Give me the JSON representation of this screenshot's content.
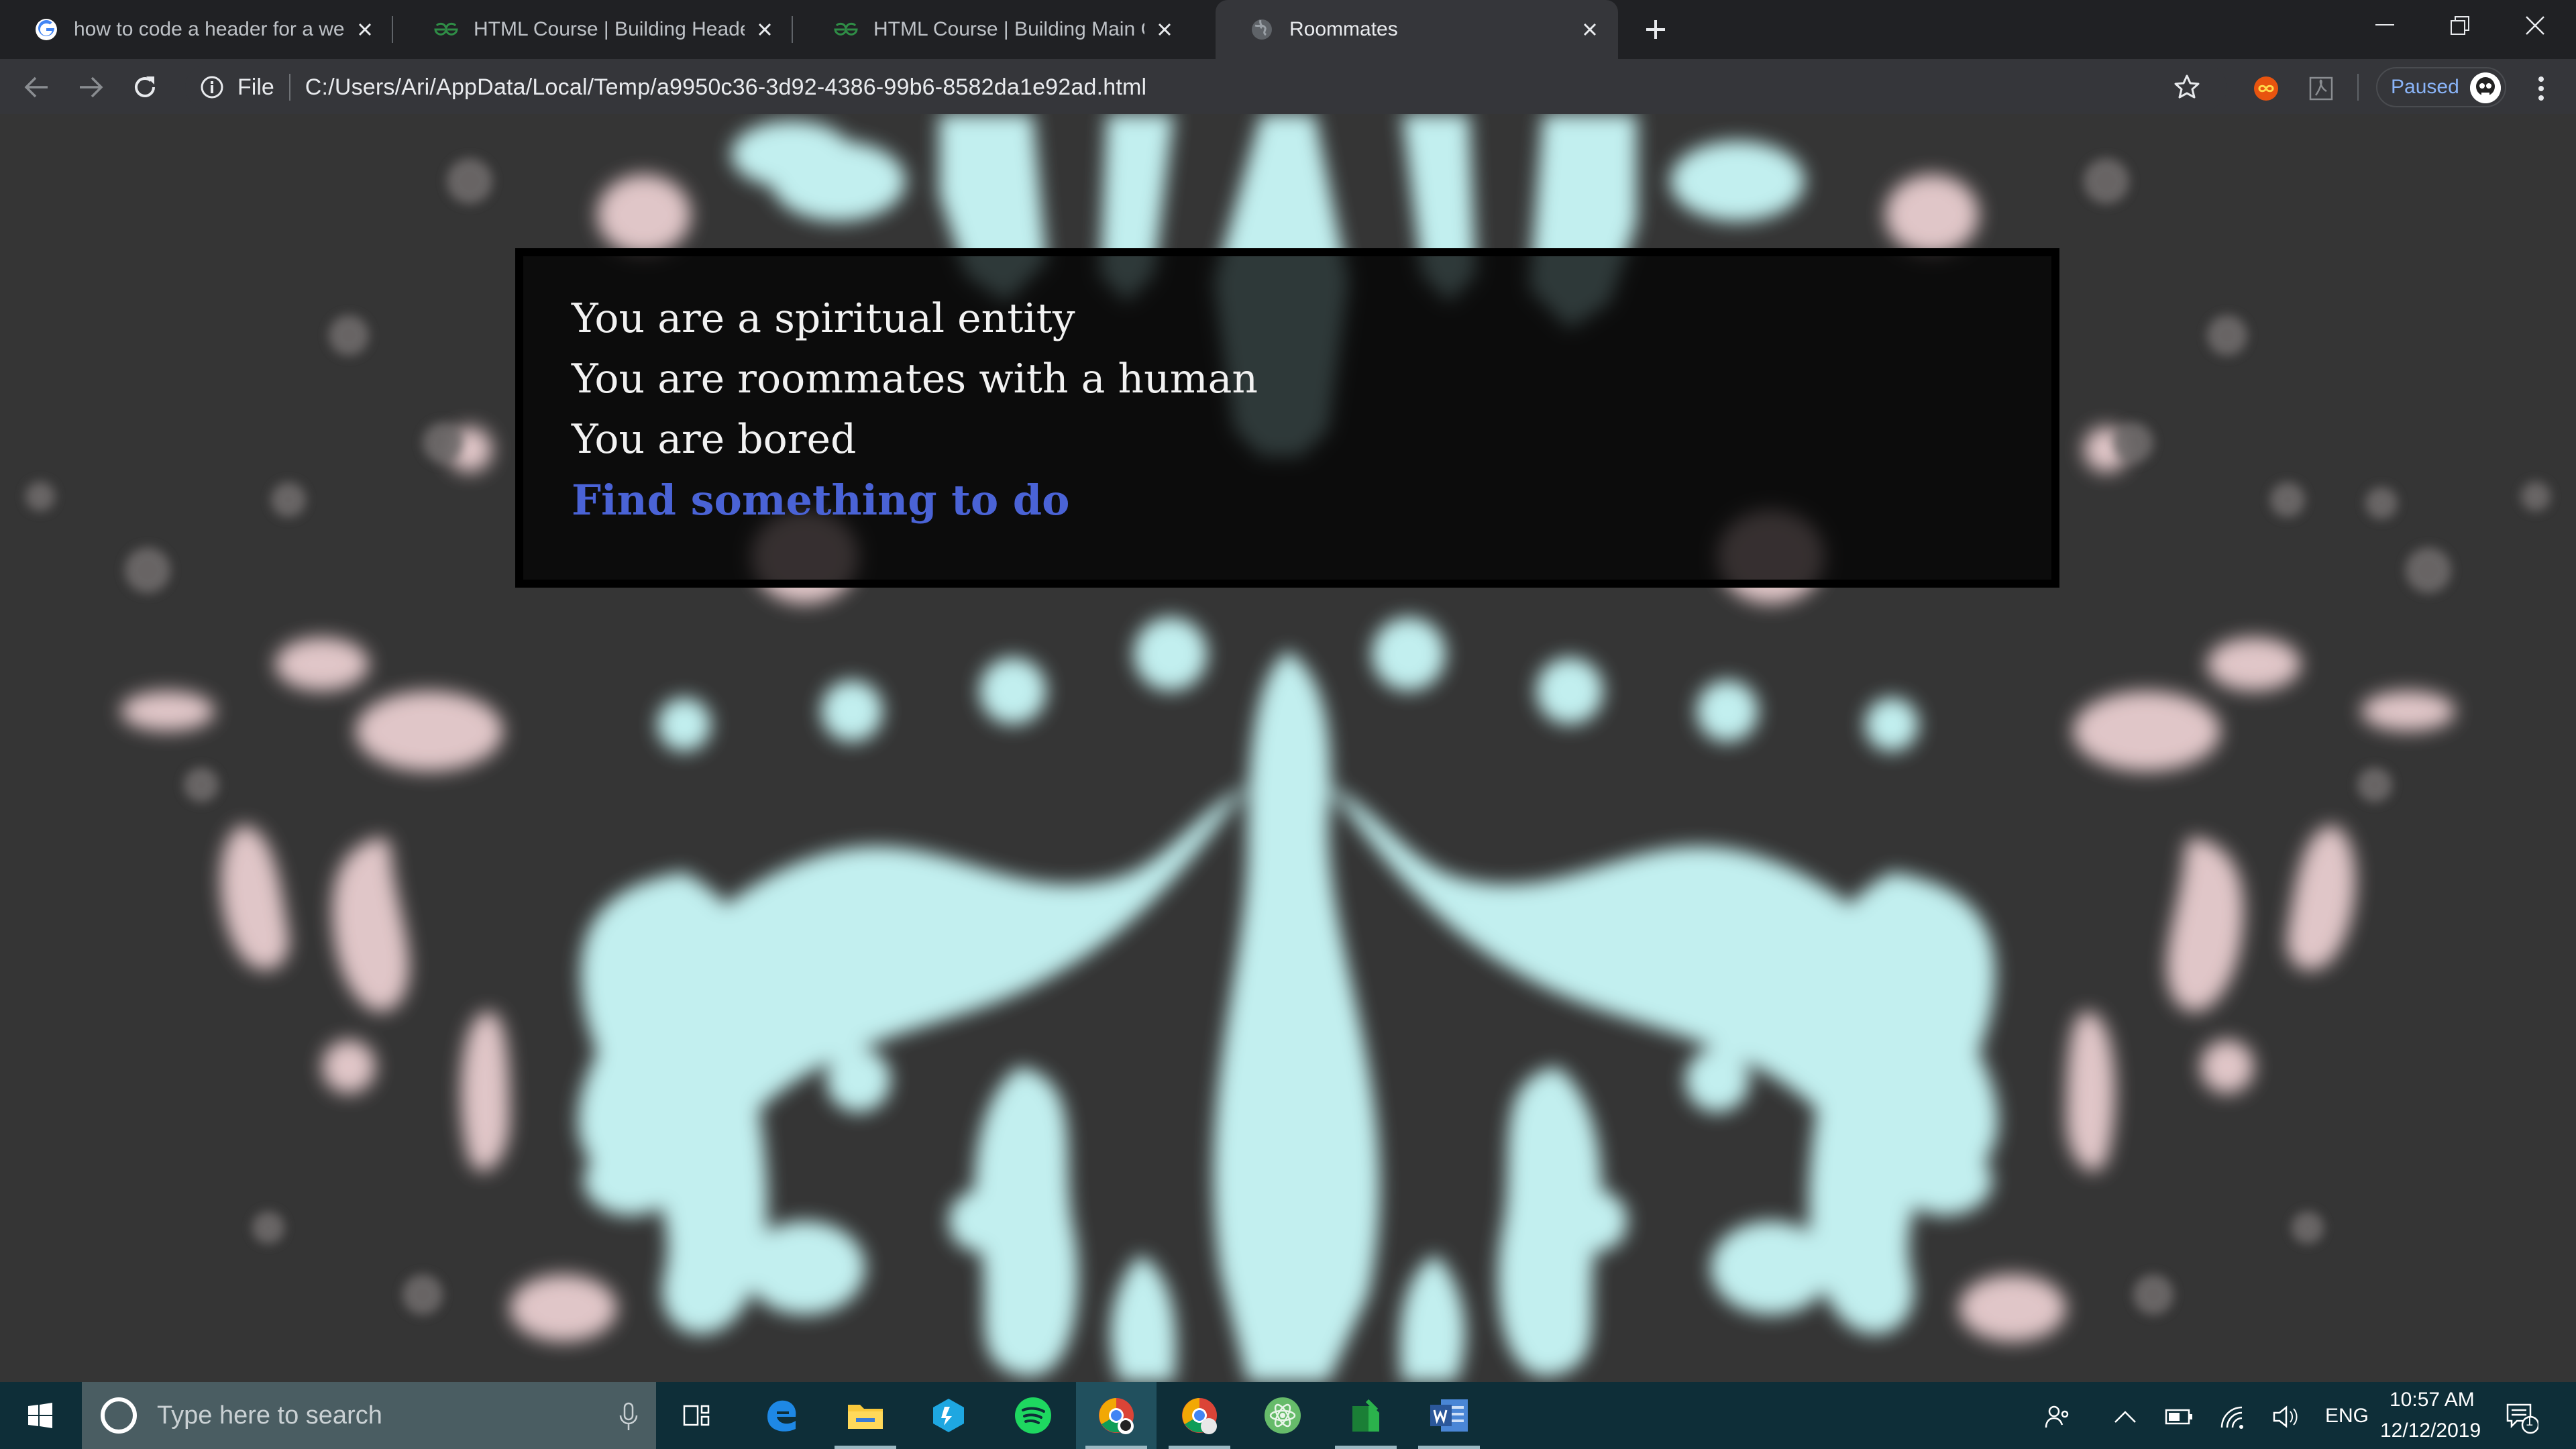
{
  "browser": {
    "tabs": [
      {
        "title": "how to code a header for a website",
        "favicon": "google-icon",
        "active": false
      },
      {
        "title": "HTML Course | Building Header of the Website",
        "favicon": "geeksforgeeks-icon",
        "active": false
      },
      {
        "title": "HTML Course | Building Main Content",
        "favicon": "geeksforgeeks-icon",
        "active": false
      },
      {
        "title": "Roommates",
        "favicon": "globe-icon",
        "active": true
      }
    ],
    "address_bar": {
      "scheme_label": "File",
      "url": "C:/Users/Ari/AppData/Local/Temp/a9950c36-3d92-4386-99b6-8582da1e92ad.html"
    },
    "profile": {
      "status_label": "Paused"
    }
  },
  "page": {
    "lines": [
      "You are a spiritual entity",
      "You are roommates with a human",
      "You are bored"
    ],
    "action_link": "Find something to do"
  },
  "taskbar": {
    "search_placeholder": "Type here to search",
    "apps": [
      "task-view",
      "edge",
      "file-explorer",
      "box",
      "spotify",
      "chrome-profile",
      "chrome",
      "atom",
      "feedly",
      "word"
    ],
    "language": "ENG",
    "time": "10:57 AM",
    "date": "12/12/2019",
    "notification_count": "1"
  },
  "colors": {
    "tabstrip": "#202124",
    "toolbar": "#35363a",
    "page_bg": "#353535",
    "blob_cyan": "#c8f7f7",
    "blob_pink": "#f3d6d8",
    "link_blue": "#4a63d6",
    "taskbar": "#0e2e38"
  }
}
